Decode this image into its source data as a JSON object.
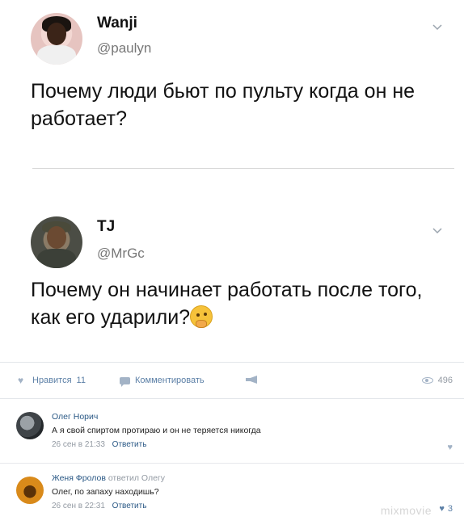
{
  "tweets": [
    {
      "name": "Wanji",
      "handle": "@paulyn",
      "text": "Почему люди бьют по пульту когда он не работает?"
    },
    {
      "name": "TJ",
      "handle": "@MrGc",
      "text": "Почему он начинает работать после того, как его ударили?",
      "emoji_icon": "thinking-face-icon"
    }
  ],
  "actions": {
    "like_label": "Нравится",
    "like_count": "11",
    "comment_label": "Комментировать",
    "views_count": "496"
  },
  "comments": [
    {
      "author": "Олег Норич",
      "text": "А я свой спиртом протираю и он не теряется никогда",
      "date": "26 сен в 21:33",
      "reply_label": "Ответить",
      "likes": ""
    },
    {
      "author": "Женя Фролов",
      "reply_to": "ответил Олегу",
      "text": "Олег, по запаху находишь?",
      "date": "26 сен в 22:31",
      "reply_label": "Ответить",
      "likes": "3"
    }
  ],
  "watermark": "mixmovie",
  "colors": {
    "link": "#2a5885",
    "meta": "#939aa3",
    "icon": "#a3b3c6"
  }
}
